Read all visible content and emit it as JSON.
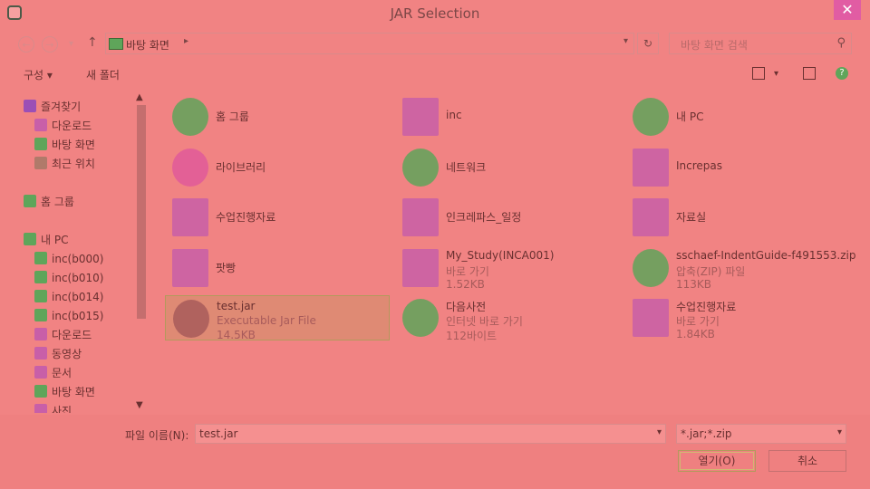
{
  "window": {
    "title": "JAR Selection",
    "close_glyph": "✕"
  },
  "nav": {
    "back_glyph": "←",
    "forward_glyph": "→",
    "recent_glyph": "▾",
    "up_glyph": "↑",
    "address": "바탕 화면",
    "address_arrow": "▸",
    "address_dropdown": "▾",
    "refresh_glyph": "↻",
    "search_placeholder": "바탕 화면 검색",
    "search_glyph": "⚲"
  },
  "toolbar": {
    "organize": "구성 ▾",
    "new_folder": "새 폴더",
    "view_drop": "▾",
    "help_glyph": "?"
  },
  "sidebar": {
    "items": [
      {
        "label": "즐겨찾기",
        "icon": "star-icon",
        "color": "#9b4fb6"
      },
      {
        "label": "다운로드",
        "icon": "download-folder-icon",
        "color": "#c85fa8"
      },
      {
        "label": "바탕 화면",
        "icon": "desktop-icon",
        "color": "#5fa55a"
      },
      {
        "label": "최근 위치",
        "icon": "recent-places-icon",
        "color": "#b07a6a"
      },
      {
        "label": "홈 그룹",
        "icon": "homegroup-icon",
        "color": "#5fa55a"
      },
      {
        "label": "내 PC",
        "icon": "pc-icon",
        "color": "#5fa55a"
      },
      {
        "label": "inc(b000)",
        "icon": "network-drive-icon",
        "color": "#5fa55a"
      },
      {
        "label": "inc(b010)",
        "icon": "network-drive-icon",
        "color": "#5fa55a"
      },
      {
        "label": "inc(b014)",
        "icon": "network-drive-icon",
        "color": "#5fa55a"
      },
      {
        "label": "inc(b015)",
        "icon": "network-drive-icon",
        "color": "#5fa55a"
      },
      {
        "label": "다운로드",
        "icon": "download-folder-icon",
        "color": "#c85fa8"
      },
      {
        "label": "동영상",
        "icon": "videos-folder-icon",
        "color": "#c85fa8"
      },
      {
        "label": "문서",
        "icon": "documents-folder-icon",
        "color": "#c85fa8"
      },
      {
        "label": "바탕 화면",
        "icon": "desktop-icon",
        "color": "#5fa55a"
      },
      {
        "label": "사진",
        "icon": "pictures-folder-icon",
        "color": "#c85fa8"
      }
    ],
    "scroll_up": "▲",
    "scroll_down": "▼"
  },
  "files": [
    {
      "name": "홈 그룹",
      "type": "",
      "size": "",
      "icon": "homegroup-icon",
      "color": "#5fa55a"
    },
    {
      "name": "inc",
      "type": "",
      "size": "",
      "icon": "network-folder-icon",
      "color": "#c85fa8"
    },
    {
      "name": "내 PC",
      "type": "",
      "size": "",
      "icon": "pc-icon",
      "color": "#5fa55a"
    },
    {
      "name": "라이브러리",
      "type": "",
      "size": "",
      "icon": "libraries-icon",
      "color": "#e05a9a"
    },
    {
      "name": "네트워크",
      "type": "",
      "size": "",
      "icon": "network-icon",
      "color": "#5fa55a"
    },
    {
      "name": "Increpas",
      "type": "",
      "size": "",
      "icon": "folder-icon",
      "color": "#c85fa8"
    },
    {
      "name": "수업진행자료",
      "type": "",
      "size": "",
      "icon": "folder-icon",
      "color": "#c85fa8"
    },
    {
      "name": "인크레파스_일정",
      "type": "",
      "size": "",
      "icon": "folder-icon",
      "color": "#c85fa8"
    },
    {
      "name": "자료실",
      "type": "",
      "size": "",
      "icon": "folder-icon",
      "color": "#c85fa8"
    },
    {
      "name": "팟빵",
      "type": "",
      "size": "",
      "icon": "folder-icon",
      "color": "#c85fa8"
    },
    {
      "name": "My_Study(INCA001)",
      "type": "바로 가기",
      "size": "1.52KB",
      "icon": "folder-shortcut-icon",
      "color": "#c85fa8"
    },
    {
      "name": "sschaef-IndentGuide-f491553.zip",
      "type": "압축(ZIP) 파일",
      "size": "113KB",
      "icon": "zip-icon",
      "color": "#5fa55a"
    },
    {
      "name": "test.jar",
      "type": "Executable Jar File",
      "size": "14.5KB",
      "icon": "java-icon",
      "color": "#a85b5b",
      "selected": true
    },
    {
      "name": "다음사전",
      "type": "인터넷 바로 가기",
      "size": "112바이트",
      "icon": "internet-shortcut-icon",
      "color": "#5fa55a"
    },
    {
      "name": "수업진행자료",
      "type": "바로 가기",
      "size": "1.84KB",
      "icon": "folder-shortcut-icon",
      "color": "#c85fa8"
    }
  ],
  "footer": {
    "filename_label": "파일 이름(N):",
    "filename_value": "test.jar",
    "filename_drop": "▾",
    "filter_value": "*.jar;*.zip",
    "filter_drop": "▾",
    "open_label": "열기(O)",
    "cancel_label": "취소"
  }
}
